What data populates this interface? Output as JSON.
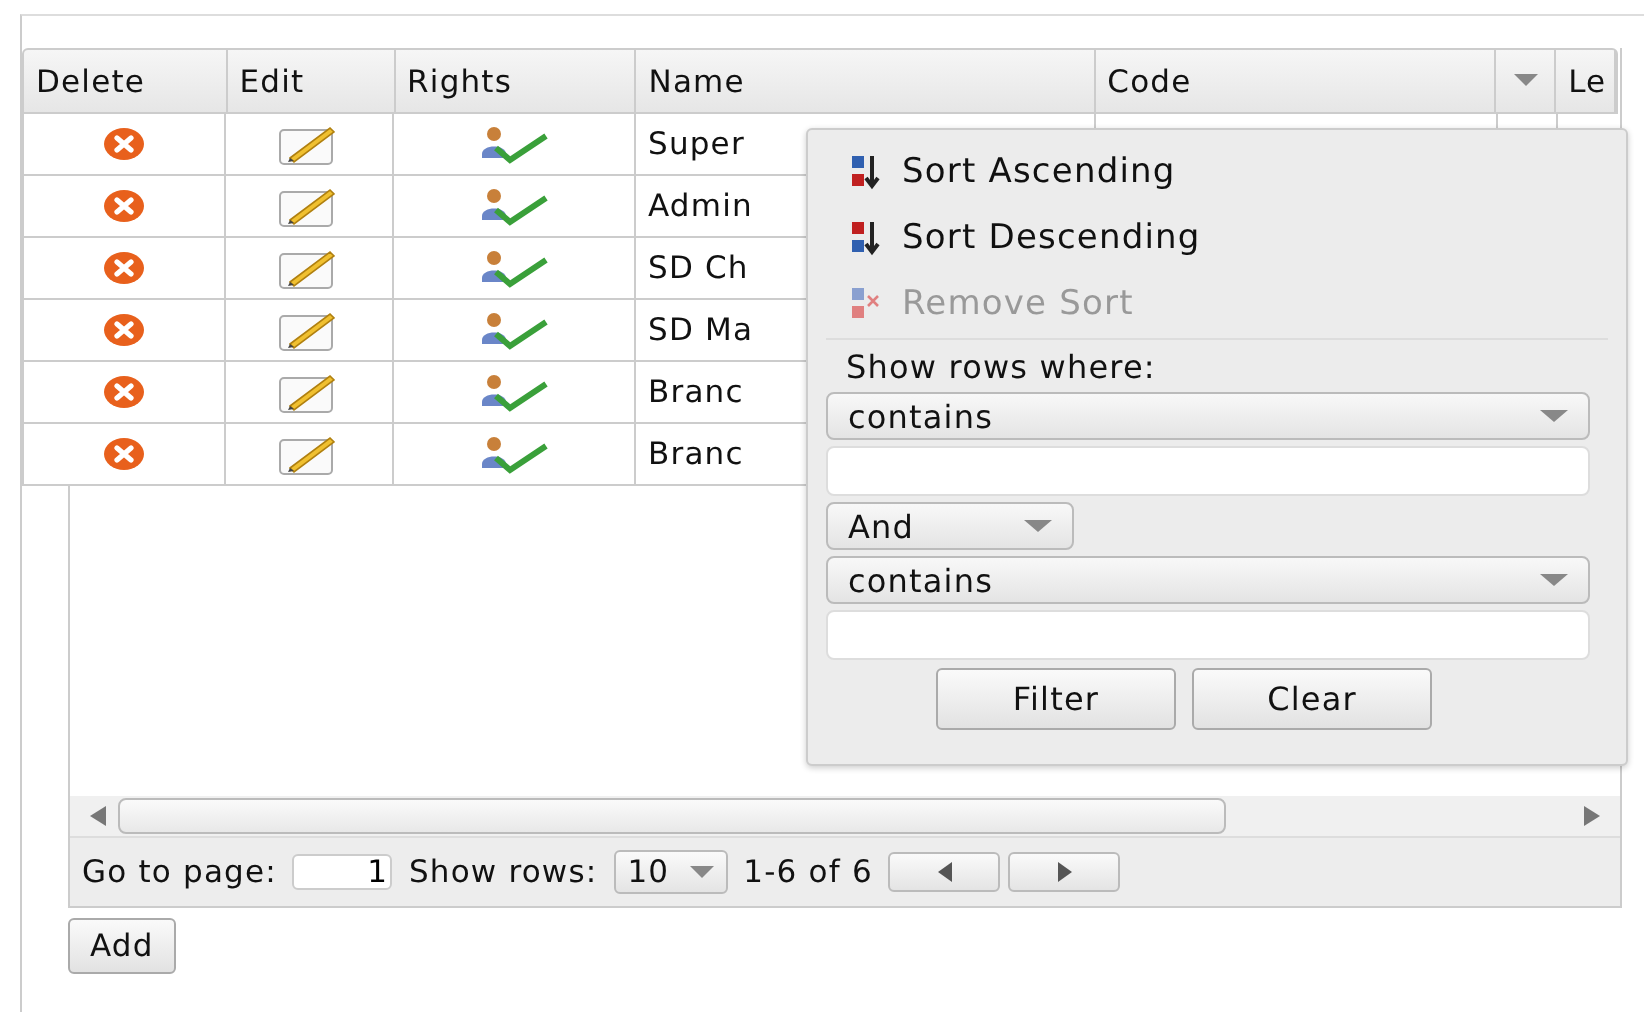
{
  "table": {
    "columns": [
      {
        "label": "Delete",
        "kind": "delete"
      },
      {
        "label": "Edit",
        "kind": "edit"
      },
      {
        "label": "Rights",
        "kind": "rights"
      },
      {
        "label": "Name",
        "kind": "text"
      },
      {
        "label": "Code",
        "kind": "text",
        "menu_open": true
      },
      {
        "label": "Le",
        "kind": "text"
      }
    ],
    "rows": [
      {
        "name": "Super"
      },
      {
        "name": "Admin"
      },
      {
        "name": "SD Ch"
      },
      {
        "name": "SD Ma"
      },
      {
        "name": "Branc"
      },
      {
        "name": "Branc"
      }
    ]
  },
  "column_menu": {
    "items": [
      {
        "label": "Sort Ascending",
        "kind": "asc",
        "disabled": false
      },
      {
        "label": "Sort Descending",
        "kind": "desc",
        "disabled": false
      },
      {
        "label": "Remove Sort",
        "kind": "remove",
        "disabled": true
      }
    ],
    "filter_heading": "Show rows where:",
    "condition_1": "contains",
    "operator": "And",
    "condition_2": "contains",
    "buttons": [
      "Filter",
      "Clear"
    ]
  },
  "pager": {
    "goto_label": "Go to page:",
    "page": "1",
    "rows_label": "Show rows:",
    "rows_value": "10",
    "range": "1-6 of 6"
  },
  "add_button": "Add"
}
